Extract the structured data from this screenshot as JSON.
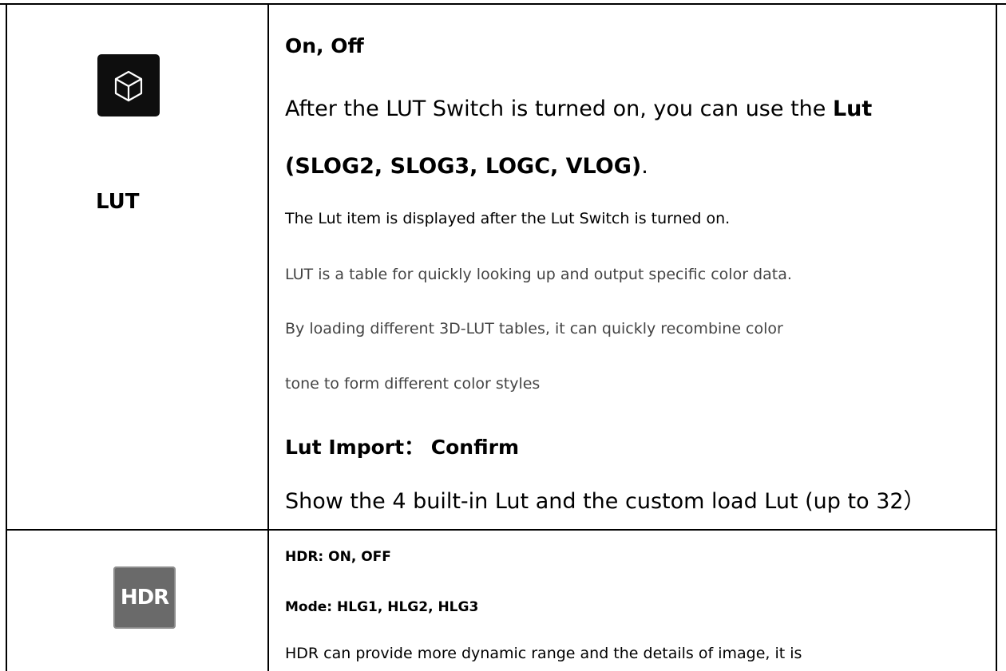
{
  "lut_row": {
    "icon": "cube-icon",
    "label": "LUT",
    "options": "On, Off",
    "desc_line1_text": "After the LUT Switch is turned on, you can use the ",
    "desc_line1_bold": "Lut",
    "desc_line2_bold": "(SLOG2, SLOG3, LOGC, VLOG)",
    "desc_line2_end": ".",
    "item_note": "The Lut item is displayed after the Lut Switch is turned on.",
    "explain_1": "LUT is a table for quickly looking up and output specific color data.",
    "explain_2": "By loading different 3D-LUT tables, it can quickly recombine color",
    "explain_3": "tone to form different color styles",
    "import_label": "Lut Import： Confirm",
    "import_desc": "Show the 4 built-in Lut and the custom load Lut (up to 32）"
  },
  "hdr_row": {
    "icon": "hdr-badge-icon",
    "icon_text": "HDR",
    "hdr_options": "HDR: ON, OFF",
    "mode_options": "Mode: HLG1, HLG2, HLG3",
    "desc": "HDR can provide more dynamic range and the details of image, it is"
  },
  "colors": {
    "border": "#000000",
    "lut_icon_bg": "#0e0e0e",
    "hdr_icon_bg": "#6a6a6a"
  }
}
